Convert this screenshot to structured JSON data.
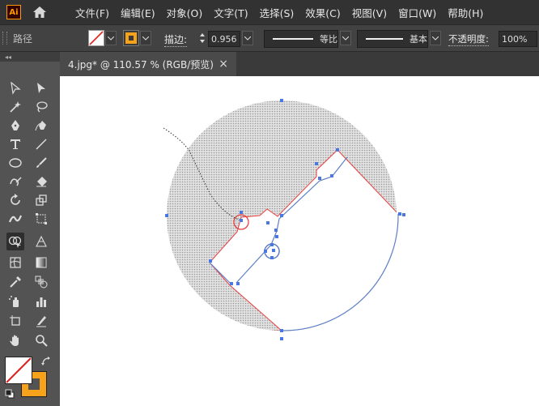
{
  "app": {
    "logo_text": "Ai"
  },
  "menu": [
    "文件(F)",
    "编辑(E)",
    "对象(O)",
    "文字(T)",
    "选择(S)",
    "效果(C)",
    "视图(V)",
    "窗口(W)",
    "帮助(H)"
  ],
  "control_bar": {
    "selection_label": "路径",
    "stroke_label": "描边:",
    "stroke_value": "0.956",
    "profile_label": "等比",
    "brush_label": "基本",
    "opacity_label": "不透明度:",
    "opacity_value": "100%"
  },
  "document": {
    "tab_title": "4.jpg* @ 110.57 % (RGB/预览)",
    "close_glyph": "×"
  },
  "toolbar": {
    "collapse_glyph": "◂◂"
  },
  "colors": {
    "menubar": "#323232",
    "control_bar": "#424242",
    "workspace": "#535353",
    "canvas": "#ffffff",
    "path_red": "#e8403f",
    "path_blue": "#4a78e0",
    "fill_swatch": "#f7a21b"
  }
}
